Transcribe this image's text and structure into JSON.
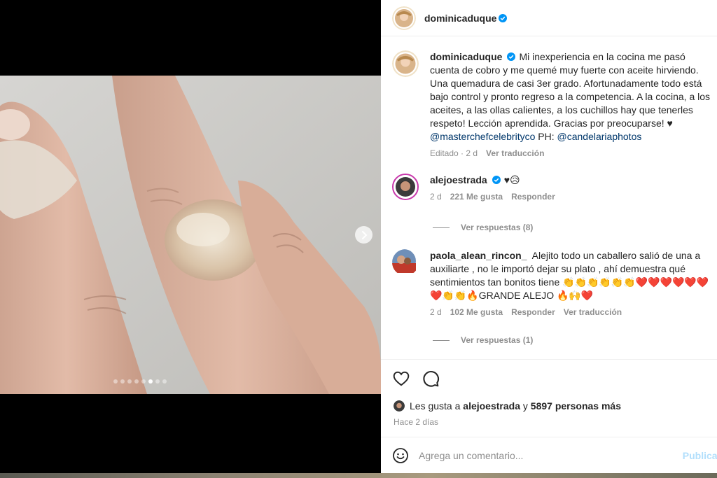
{
  "post": {
    "author": "dominicaduque",
    "slide_count": 8,
    "active_slide": 5
  },
  "caption": {
    "username": "dominicaduque",
    "text": "Mi inexperiencia en la cocina me pasó cuenta de cobro y me quemé muy fuerte con aceite hirviendo. Una quemadura de casi 3er grado. Afortunadamente todo está bajo control y pronto regreso a la competencia. A la cocina, a los aceites, a las ollas calientes, a los cuchillos hay que tenerles respeto! Lección aprendida. Gracias por preocuparse! ♥",
    "mention1": "@masterchefcelebrityco",
    "ph": "PH:",
    "mention2": "@candelariaphotos",
    "edited": "Editado · 2 d",
    "translate": "Ver traducción"
  },
  "comments": [
    {
      "username": "alejoestrada",
      "text": "♥😥",
      "time": "2 d",
      "likes": "221 Me gusta",
      "reply": "Responder",
      "view_replies": "Ver respuestas (8)"
    },
    {
      "username": "paola_alean_rincon_",
      "text": "Alejito todo un caballero salió de una a auxiliarte , no le importó dejar su plato , ahí demuestra qué sentimientos tan bonitos tiene 👏👏👏👏👏👏❤️❤️❤️❤️❤️❤️❤️👏👏🔥GRANDE ALEJO 🔥🙌❤️",
      "time": "2 d",
      "likes": "102 Me gusta",
      "reply": "Responder",
      "translate": "Ver traducción",
      "view_replies": "Ver respuestas (1)"
    }
  ],
  "likes": {
    "prefix": "Les gusta a",
    "user": "alejoestrada",
    "joiner": "y",
    "others": "5897 personas más"
  },
  "ago": "Hace 2 días",
  "add_comment": {
    "placeholder": "Agrega un comentario...",
    "publish": "Publicar"
  },
  "icons": {
    "verified": "verified-badge-icon",
    "like": "heart-icon",
    "comment": "comment-bubble-icon",
    "emoji": "emoji-face-icon",
    "next": "chevron-right-icon"
  },
  "colors": {
    "verified": "#0095f6",
    "link": "#00376b",
    "muted": "#8e8e8e",
    "publish": "#b2dffc"
  }
}
